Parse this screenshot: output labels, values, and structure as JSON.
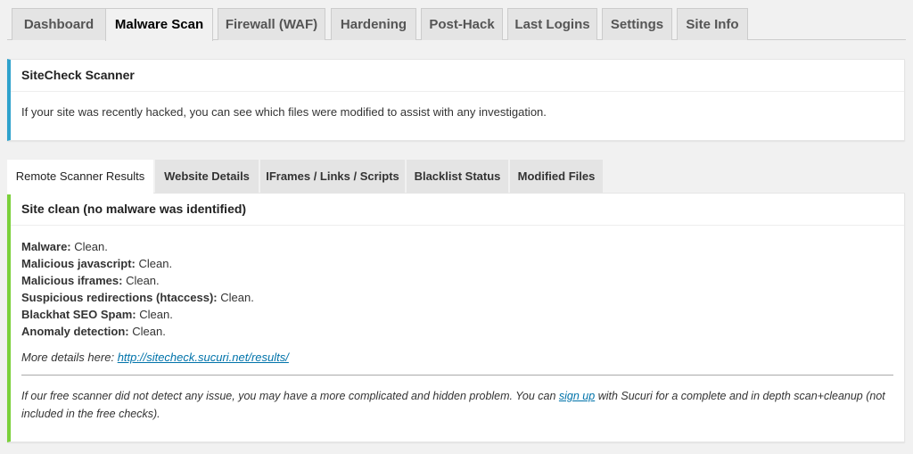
{
  "nav_tabs": [
    {
      "label": "Dashboard",
      "active": false
    },
    {
      "label": "Malware Scan",
      "active": true
    },
    {
      "label": "Firewall (WAF)",
      "active": false
    },
    {
      "label": "Hardening",
      "active": false
    },
    {
      "label": "Post-Hack",
      "active": false
    },
    {
      "label": "Last Logins",
      "active": false
    },
    {
      "label": "Settings",
      "active": false
    },
    {
      "label": "Site Info",
      "active": false
    }
  ],
  "info_panel": {
    "title": "SiteCheck Scanner",
    "description": "If your site was recently hacked, you can see which files were modified to assist with any investigation."
  },
  "sub_tabs": [
    {
      "label": "Remote Scanner Results",
      "active": true
    },
    {
      "label": "Website Details",
      "active": false
    },
    {
      "label": "IFrames / Links / Scripts",
      "active": false
    },
    {
      "label": "Blacklist Status",
      "active": false
    },
    {
      "label": "Modified Files",
      "active": false
    }
  ],
  "result_panel": {
    "title": "Site clean (no malware was identified)",
    "checks": [
      {
        "label": "Malware:",
        "value": "Clean."
      },
      {
        "label": "Malicious javascript:",
        "value": "Clean."
      },
      {
        "label": "Malicious iframes:",
        "value": "Clean."
      },
      {
        "label": "Suspicious redirections (htaccess):",
        "value": "Clean."
      },
      {
        "label": "Blackhat SEO Spam:",
        "value": "Clean."
      },
      {
        "label": "Anomaly detection:",
        "value": "Clean."
      }
    ],
    "more_details_label": "More details here:",
    "more_details_link": "http://sitecheck.sucuri.net/results/",
    "note_before": "If our free scanner did not detect any issue, you may have a more complicated and hidden problem. You can ",
    "note_link": "sign up",
    "note_after": " with Sucuri for a complete and in depth scan+cleanup (not included in the free checks)."
  },
  "colors": {
    "info_accent": "#2ea2cc",
    "success_accent": "#7ad03a",
    "link": "#0073aa"
  }
}
